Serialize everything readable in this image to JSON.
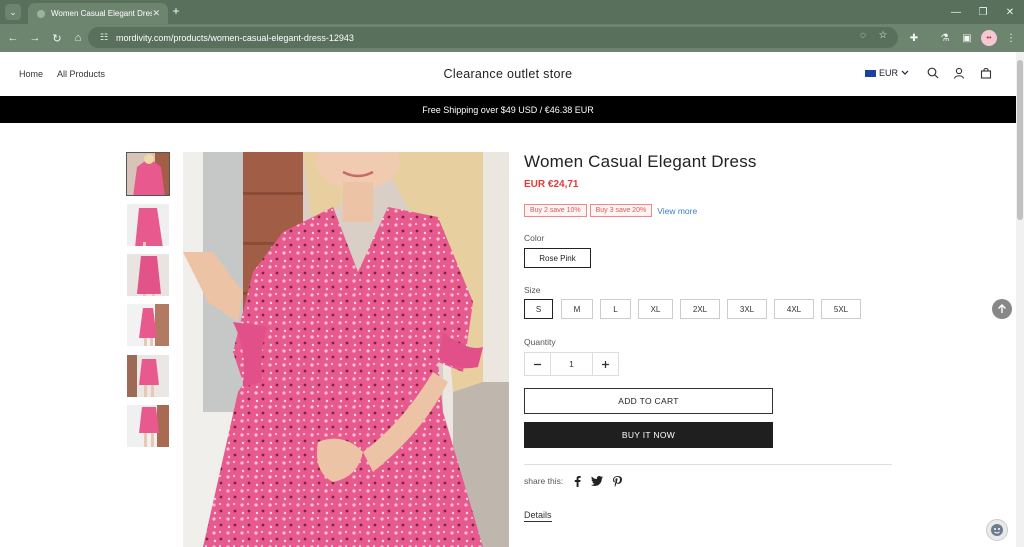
{
  "browser": {
    "tab_title": "Women Casual Elegant Dress",
    "tab_close": "✕",
    "new_tab": "+",
    "url": "mordivity.com/products/women-casual-elegant-dress-12943",
    "profile_initial": "••"
  },
  "header": {
    "nav": [
      "Home",
      "All Products"
    ],
    "store_title": "Clearance outlet store",
    "currency": "EUR"
  },
  "banner": {
    "text": "Free Shipping over $49 USD / €46.38 EUR"
  },
  "product": {
    "title": "Women Casual Elegant Dress",
    "price": "EUR €24,71",
    "promos": [
      "Buy 2 save 10%",
      "Buy 3 save 20%"
    ],
    "view_more": "View more",
    "color_label": "Color",
    "color_selected": "Rose Pink",
    "size_label": "Size",
    "sizes": [
      "S",
      "M",
      "L",
      "XL",
      "2XL",
      "3XL",
      "4XL",
      "5XL"
    ],
    "selected_size": "S",
    "quantity_label": "Quantity",
    "quantity": "1",
    "add_to_cart": "ADD TO CART",
    "buy_now": "BUY IT NOW",
    "share_label": "share this:",
    "details_link": "Details"
  },
  "colors": {
    "accent_price": "#e03b3b",
    "banner_bg": "#000000",
    "browser_frame": "#58705c",
    "dress_pink": "#e85a8e"
  }
}
